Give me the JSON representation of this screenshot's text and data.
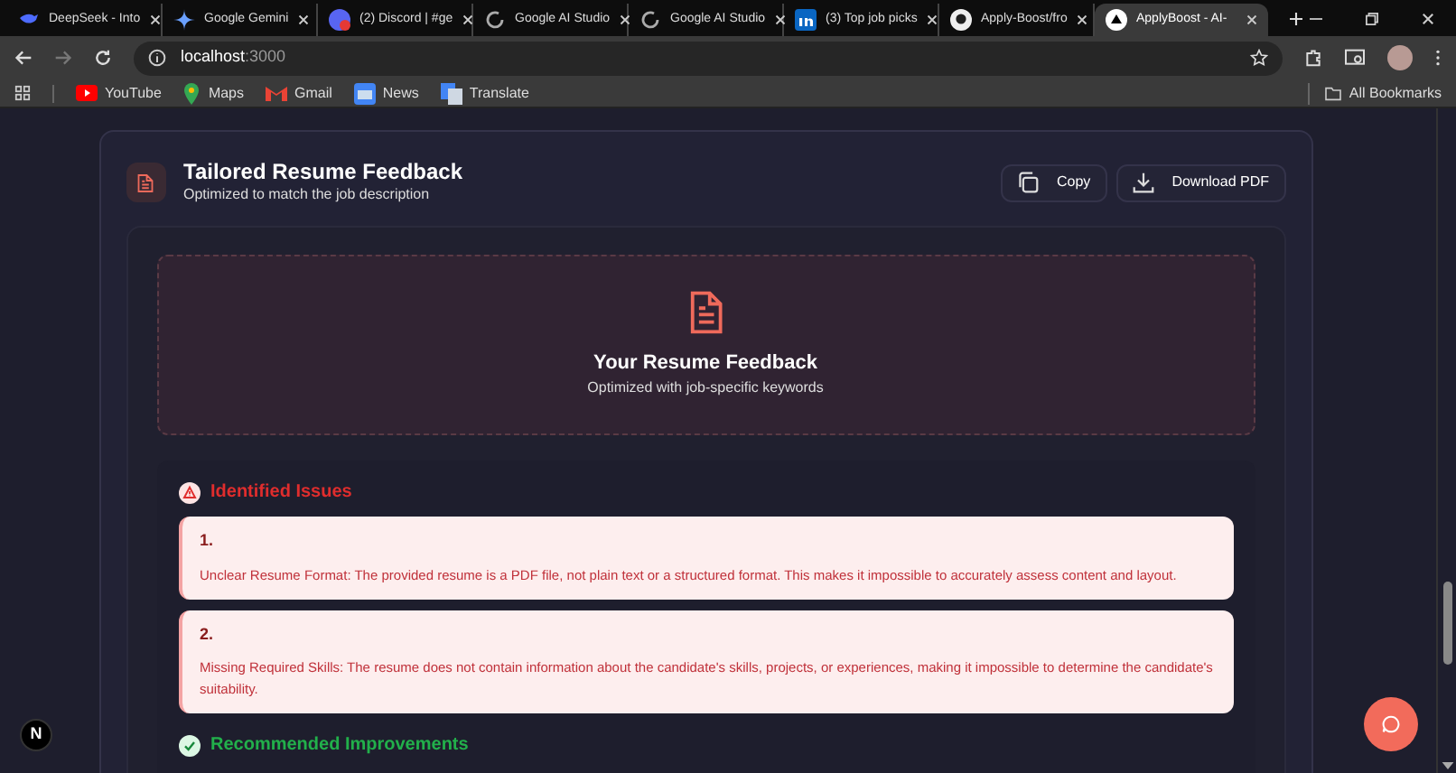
{
  "browser": {
    "tabs": [
      {
        "title": "DeepSeek - Into",
        "selected": false
      },
      {
        "title": "Google Gemini",
        "selected": false
      },
      {
        "title": "(2) Discord | #ge",
        "selected": false
      },
      {
        "title": "Google AI Studio",
        "selected": false
      },
      {
        "title": "Google AI Studio",
        "selected": false
      },
      {
        "title": "(3) Top job picks",
        "selected": false
      },
      {
        "title": "Apply-Boost/fro",
        "selected": false
      },
      {
        "title": "ApplyBoost - AI-",
        "selected": true
      }
    ],
    "url_host": "localhost",
    "url_port": ":3000",
    "bookmarks": [
      "YouTube",
      "Maps",
      "Gmail",
      "News",
      "Translate"
    ],
    "all_bookmarks": "All Bookmarks"
  },
  "header": {
    "title": "Tailored Resume Feedback",
    "subtitle": "Optimized to match the job description",
    "buttons": [
      "Copy",
      "Download PDF"
    ]
  },
  "banner": {
    "title": "Your Resume Feedback",
    "subtitle": "Optimized with job-specific keywords"
  },
  "sections": [
    {
      "kind": "issues",
      "title": "Identified Issues",
      "items": [
        {
          "number": "1.",
          "text": "Unclear Resume Format: The provided resume is a PDF file, not plain text or a structured format. This makes it impossible to accurately assess content and layout."
        },
        {
          "number": "2.",
          "text": "Missing Required Skills: The resume does not contain information about the candidate's skills, projects, or experiences, making it impossible to determine the candidate's suitability."
        }
      ]
    },
    {
      "kind": "improvements",
      "title": "Recommended Improvements"
    }
  ],
  "dev_badge": "N"
}
